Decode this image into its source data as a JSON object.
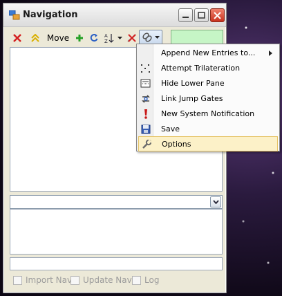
{
  "window": {
    "title": "Navigation"
  },
  "toolbar": {
    "move_label": "Move"
  },
  "menu": {
    "items": [
      {
        "label": "Append New Entries to...",
        "icon": "submenu",
        "has_submenu": true
      },
      {
        "label": "Attempt Trilateration",
        "icon": "trilateration-icon"
      },
      {
        "label": "Hide Lower Pane",
        "icon": "pane-icon"
      },
      {
        "label": "Link Jump Gates",
        "icon": "link-icon"
      },
      {
        "label": "New System Notification",
        "icon": "notification-icon"
      },
      {
        "label": "Save",
        "icon": "floppy-icon"
      },
      {
        "label": "Options",
        "icon": "wrench-icon",
        "highlighted": true
      }
    ]
  },
  "options": {
    "import_nav": {
      "label": "Import Nav",
      "checked": false,
      "enabled": false
    },
    "update_nav": {
      "label": "Update Nav",
      "checked": false,
      "enabled": false
    },
    "log": {
      "label": "Log",
      "checked": false,
      "enabled": false
    }
  },
  "colors": {
    "field_green": "#c6f5c6",
    "menu_highlight": "#fcf1c8",
    "close_red": "#c8321e"
  }
}
